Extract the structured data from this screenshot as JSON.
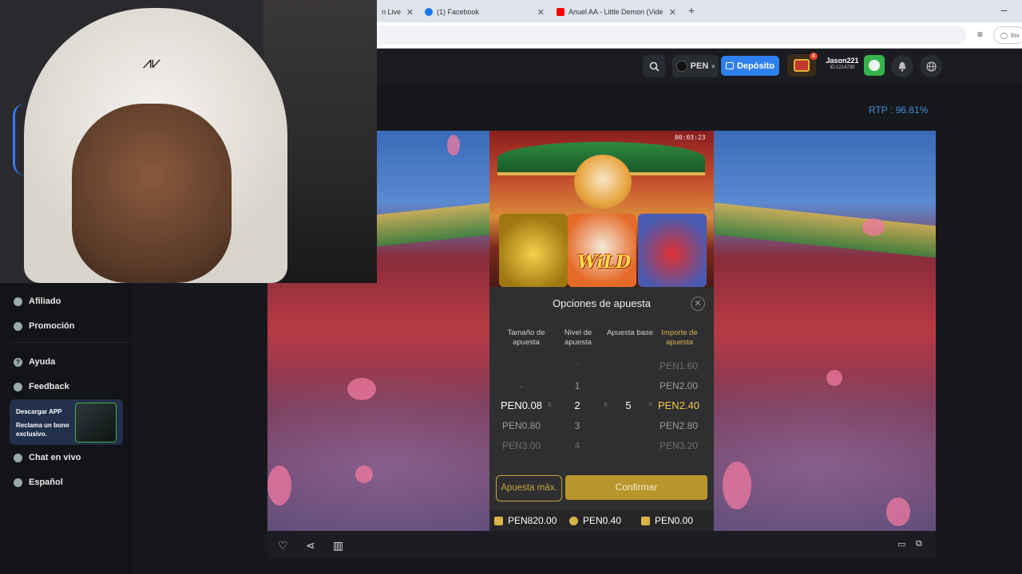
{
  "browser": {
    "tabs": [
      {
        "title": "n Live",
        "favicon_color": "#e3e3e3"
      },
      {
        "title": "(1) Facebook",
        "favicon_color": "#1877f2"
      },
      {
        "title": "Anuel AA - Little Demon (Vide",
        "favicon_color": "#ff0000"
      }
    ],
    "new_tab": "+",
    "minimize": "–",
    "account_chip": "Inv"
  },
  "header": {
    "search_icon": "search-icon",
    "currency_label": "PEN",
    "deposit_label": "Depósito",
    "chest_badge": "4",
    "username": "Jason221",
    "user_id": "ID:1214730",
    "bell_icon": "bell-icon",
    "globe_icon": "globe-icon"
  },
  "sidebar": {
    "items": [
      {
        "label": "Afiliado",
        "icon": "affiliate-icon"
      },
      {
        "label": "Promoción",
        "icon": "promo-icon"
      },
      {
        "label": "Ayuda",
        "icon": "help-icon"
      },
      {
        "label": "Feedback",
        "icon": "feedback-icon"
      },
      {
        "label": "Chat en vivo",
        "icon": "headset-icon"
      },
      {
        "label": "Español",
        "icon": "globe-icon"
      }
    ],
    "promo": {
      "line1": "Descargar APP",
      "line2": "Reclama un bono exclusivo."
    }
  },
  "main": {
    "rtp": "RTP : 96.81%"
  },
  "game": {
    "timer": "00:03:23",
    "wild_text": "WiLD",
    "bet_options": {
      "title": "Opciones de apuesta",
      "close": "✕",
      "headers": [
        "Tamaño de apuesta",
        "Nivel de apuesta",
        "Apuesta base",
        "Importe de apuesta"
      ],
      "size_rows": [
        "-",
        "PEN0.08",
        "PEN0.80",
        "PEN3.00"
      ],
      "level_rows": [
        "-",
        "1",
        "2",
        "3",
        "4"
      ],
      "base_value": "5",
      "amount_rows": [
        "PEN1.60",
        "PEN2.00",
        "PEN2.40",
        "PEN2.80",
        "PEN3.20"
      ],
      "op_x1": "x",
      "op_x2": "x",
      "op_eq": "=",
      "max_button": "Apuesta máx.",
      "confirm_button": "Confirmar"
    },
    "footer": {
      "balance": "PEN820.00",
      "bet": "PEN0.40",
      "win": "PEN0.00"
    }
  }
}
